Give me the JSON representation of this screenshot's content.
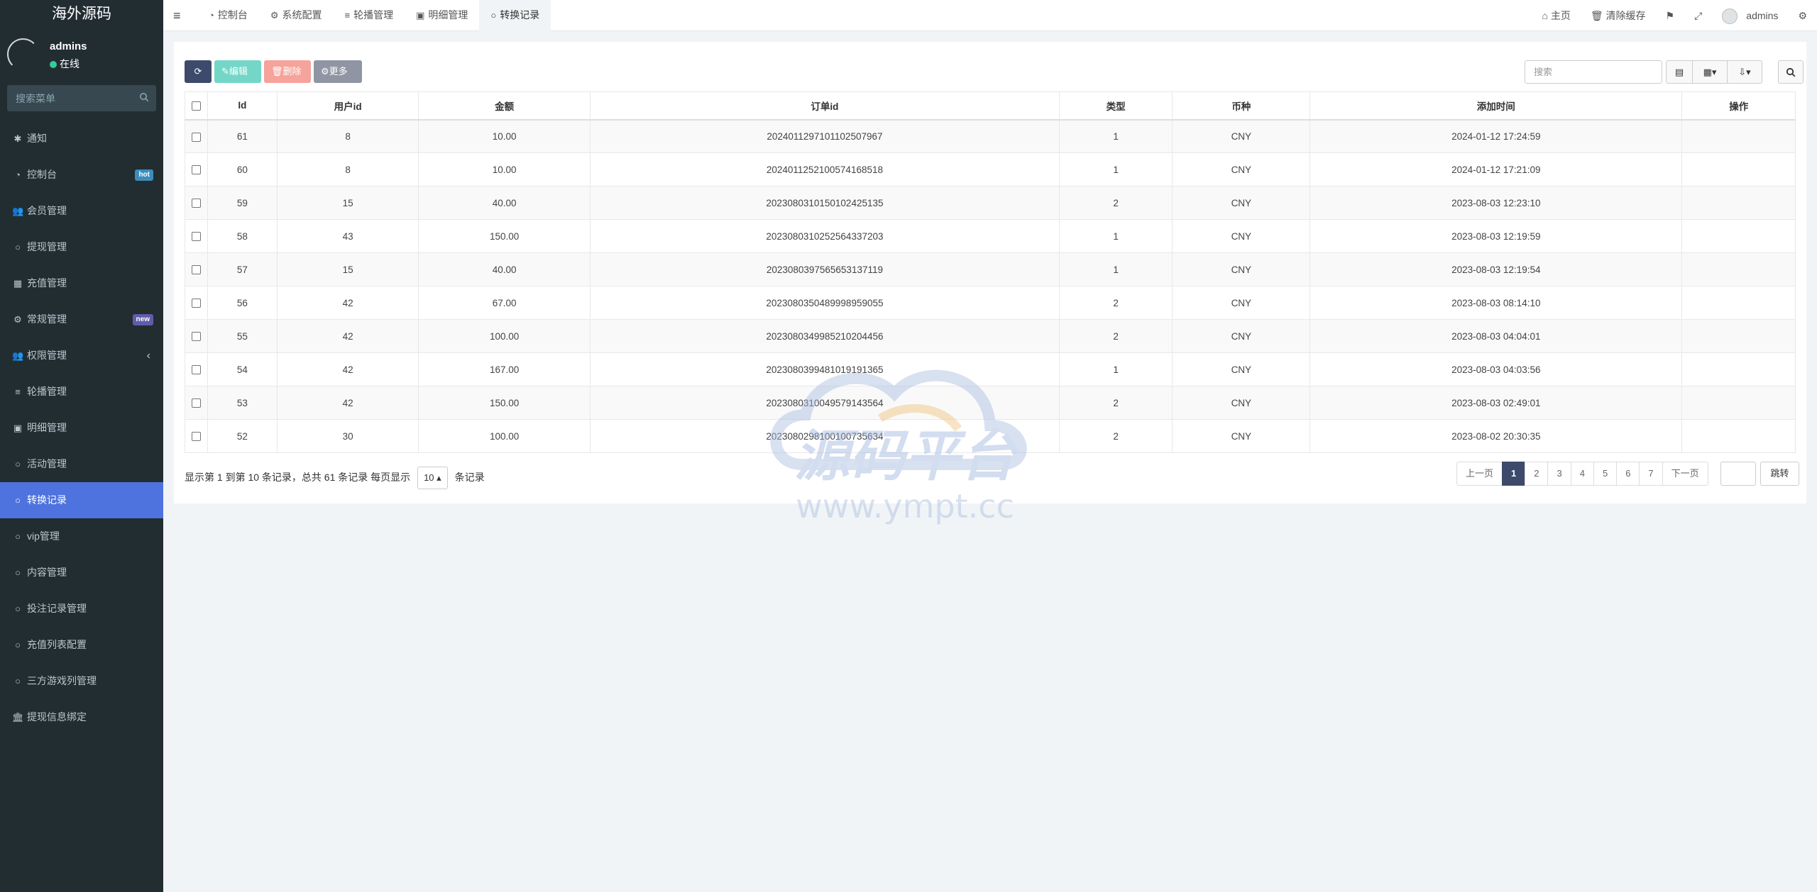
{
  "sidebar": {
    "logo": "海外源码",
    "user": {
      "name": "admins",
      "status": "在线"
    },
    "search_placeholder": "搜索菜单",
    "items": [
      {
        "label": "通知",
        "icon": "gear-small-icon"
      },
      {
        "label": "控制台",
        "icon": "dashboard-icon",
        "badge": "hot"
      },
      {
        "label": "会员管理",
        "icon": "users-icon"
      },
      {
        "label": "提现管理",
        "icon": "circle-icon"
      },
      {
        "label": "充值管理",
        "icon": "grid-icon"
      },
      {
        "label": "常规管理",
        "icon": "cogs-icon",
        "badge": "new"
      },
      {
        "label": "权限管理",
        "icon": "group-icon"
      },
      {
        "label": "轮播管理",
        "icon": "list-icon"
      },
      {
        "label": "明细管理",
        "icon": "calendar-icon"
      },
      {
        "label": "活动管理",
        "icon": "circle-icon"
      },
      {
        "label": "转换记录",
        "icon": "circle-icon",
        "active": true
      },
      {
        "label": "vip管理",
        "icon": "circle-icon"
      },
      {
        "label": "内容管理",
        "icon": "circle-icon"
      },
      {
        "label": "投注记录管理",
        "icon": "circle-icon"
      },
      {
        "label": "充值列表配置",
        "icon": "circle-icon"
      },
      {
        "label": "三方游戏列管理",
        "icon": "circle-icon"
      },
      {
        "label": "提现信息绑定",
        "icon": "bank-icon"
      }
    ]
  },
  "topbar": {
    "tabs": [
      {
        "label": "控制台",
        "icon": "dashboard-icon"
      },
      {
        "label": "系统配置",
        "icon": "gear-icon"
      },
      {
        "label": "轮播管理",
        "icon": "list-icon"
      },
      {
        "label": "明细管理",
        "icon": "calendar-icon"
      },
      {
        "label": "转换记录",
        "icon": "circle-icon",
        "active": true
      }
    ],
    "home_label": "主页",
    "clear_cache_label": "清除缓存",
    "admin_name": "admins"
  },
  "toolbar": {
    "edit_label": "编辑",
    "delete_label": "删除",
    "more_label": "更多",
    "search_placeholder": "搜索"
  },
  "table": {
    "columns": [
      "Id",
      "用户id",
      "金额",
      "订单id",
      "类型",
      "币种",
      "添加时间",
      "操作"
    ],
    "rows": [
      [
        "61",
        "8",
        "10.00",
        "202401129710110250796​7",
        "1",
        "CNY",
        "2024-01-12 17:24:59"
      ],
      [
        "60",
        "8",
        "10.00",
        "202401125210057416851​8",
        "1",
        "CNY",
        "2024-01-12 17:21:09"
      ],
      [
        "59",
        "15",
        "40.00",
        "202308031015010242513​5",
        "2",
        "CNY",
        "2023-08-03 12:23:10"
      ],
      [
        "58",
        "43",
        "150.00",
        "202308031025256433720​3",
        "1",
        "CNY",
        "2023-08-03 12:19:59"
      ],
      [
        "57",
        "15",
        "40.00",
        "202308039756565313711​9",
        "1",
        "CNY",
        "2023-08-03 12:19:54"
      ],
      [
        "56",
        "42",
        "67.00",
        "202308035048999895905​5",
        "2",
        "CNY",
        "2023-08-03 08:14:10"
      ],
      [
        "55",
        "42",
        "100.00",
        "202308034998521020445​6",
        "2",
        "CNY",
        "2023-08-03 04:04:01"
      ],
      [
        "54",
        "42",
        "167.00",
        "202308039948101919136​5",
        "1",
        "CNY",
        "2023-08-03 04:03:56"
      ],
      [
        "53",
        "42",
        "150.00",
        "202308031004957914356​4",
        "2",
        "CNY",
        "2023-08-03 02:49:01"
      ],
      [
        "52",
        "30",
        "100.00",
        "202308029810010073563​4",
        "2",
        "CNY",
        "2023-08-02 20:30:35"
      ]
    ]
  },
  "footer": {
    "info_prefix": "显示第 1 到第 10 条记录，总共 61 条记录 每页显示",
    "page_size": "10",
    "info_suffix": "条记录",
    "prev_label": "上一页",
    "pages": [
      "1",
      "2",
      "3",
      "4",
      "5",
      "6",
      "7"
    ],
    "current_page": "1",
    "next_label": "下一页",
    "jump_label": "跳转"
  },
  "watermark": {
    "title": "源码平台",
    "url": "www.ympt.cc"
  },
  "colors": {
    "sidebar_bg": "#222d32",
    "active_menu": "#4e73df",
    "primary_btn": "#3d4a6b"
  }
}
